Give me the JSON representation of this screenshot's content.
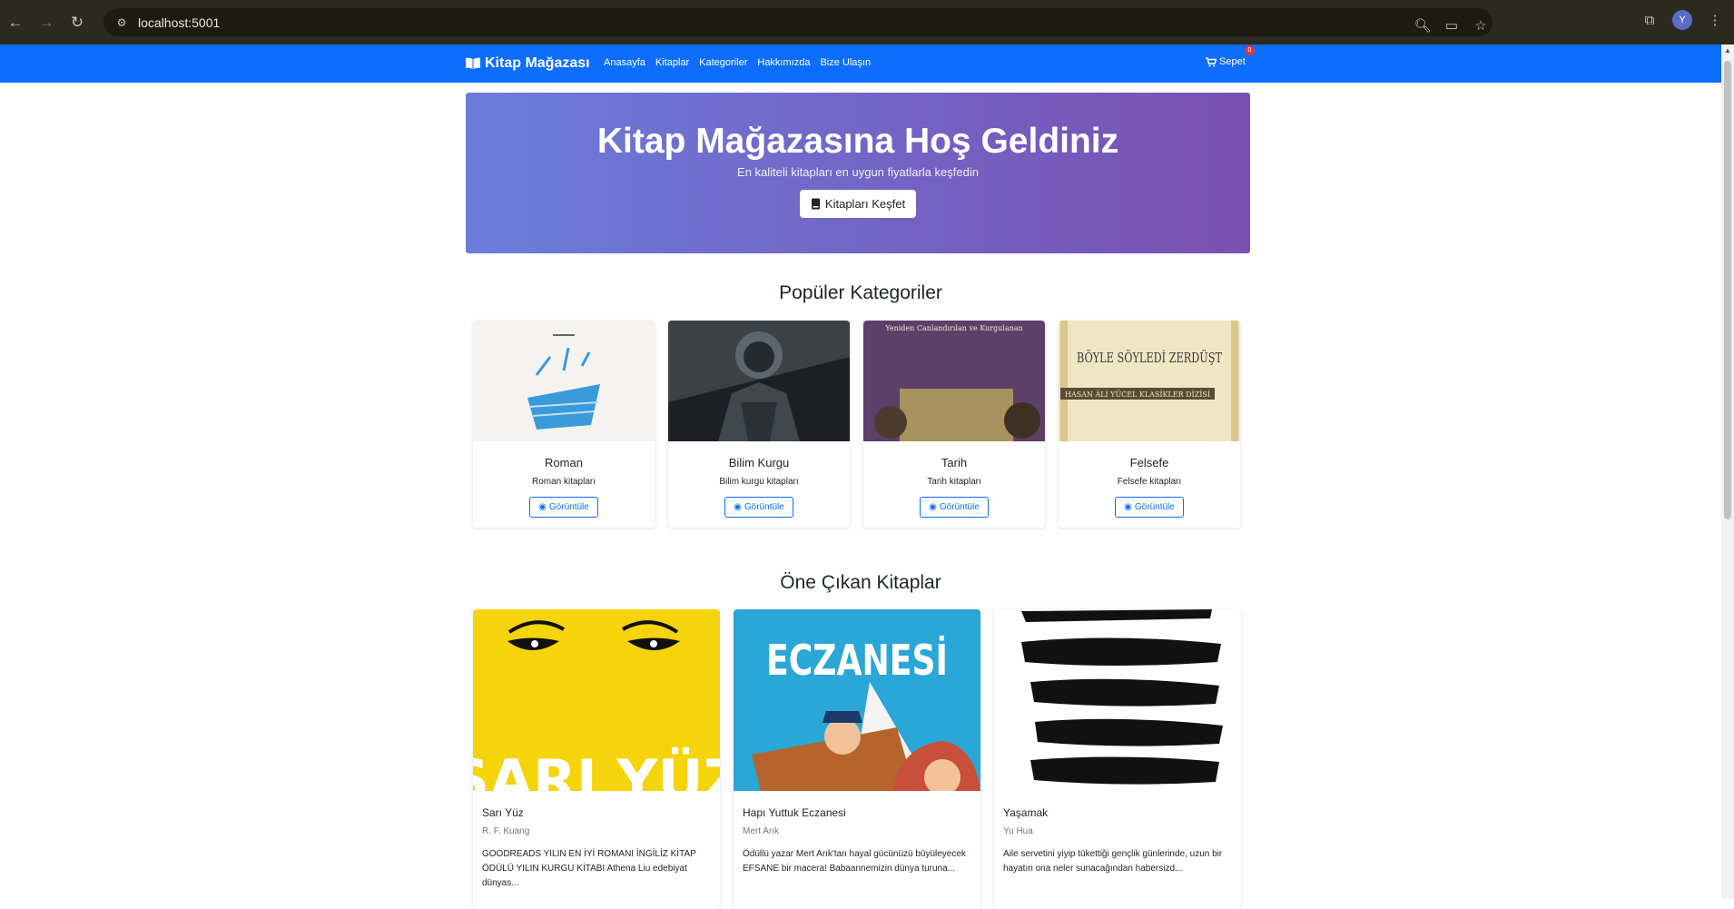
{
  "browser": {
    "url": "localhost:5001",
    "profile_initial": "Y"
  },
  "navbar": {
    "brand": "Kitap Mağazası",
    "links": [
      "Anasayfa",
      "Kitaplar",
      "Kategoriler",
      "Hakkımızda",
      "Bize Ulaşın"
    ],
    "cart_label": "Sepet",
    "cart_count": "0"
  },
  "hero": {
    "title": "Kitap Mağazasına Hoş Geldiniz",
    "subtitle": "En kaliteli kitapları en uygun fiyatlarla keşfedin",
    "button": "Kitapları Keşfet"
  },
  "categories": {
    "title": "Popüler Kategoriler",
    "button_label": "Görüntüle",
    "items": [
      {
        "name": "Roman",
        "desc": "Roman kitapları"
      },
      {
        "name": "Bilim Kurgu",
        "desc": "Bilim kurgu kitapları"
      },
      {
        "name": "Tarih",
        "desc": "Tarih kitapları"
      },
      {
        "name": "Felsefe",
        "desc": "Felsefe kitapları"
      }
    ],
    "cover_texts": {
      "tarih_top": "Yeniden Canlandırılan ve Kurgulanan",
      "felsefe_title": "BÖYLE SÖYLEDİ ZERDÜŞT",
      "felsefe_band": "HASAN ÂLİ YÜCEL KLASİKLER DİZİSİ"
    }
  },
  "featured": {
    "title": "Öne Çıkan Kitaplar",
    "items": [
      {
        "title": "Sarı Yüz",
        "author": "R. F. Kuang",
        "desc": "GOODREADS YILIN EN İYİ ROMANI İNGİLİZ KİTAP ÖDÜLÜ YILIN KURGU KİTABI Athena Liu edebiyat dünyas..."
      },
      {
        "title": "Hapı Yuttuk Eczanesi",
        "author": "Mert Arık",
        "desc": "Ödüllü yazar Mert Arık'tan hayal gücünüzü büyüleyecek EFSANE bir macera! Babaannemizin dünya turuna..."
      },
      {
        "title": "Yaşamak",
        "author": "Yu Hua",
        "desc": "Aile servetini yiyip tükettiği gençlik günlerinde, uzun bir hayatın ona neler sunacağından habersizd..."
      }
    ],
    "cover_texts": {
      "sari_yuz": "SARI YÜZ",
      "eczane": "ECZANESİ"
    }
  },
  "colors": {
    "navbar": "#0d6efd",
    "hero_start": "#6b7ddb",
    "hero_end": "#7a4fb0",
    "badge": "#dc3545"
  }
}
